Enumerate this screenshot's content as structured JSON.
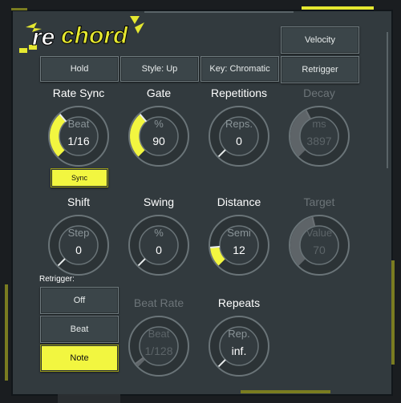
{
  "brand": {
    "logo_text": "rechord"
  },
  "colors": {
    "accent": "#f2f640",
    "panel": "#323a3e",
    "ring": "#5a6468"
  },
  "toolbar": {
    "hold": "Hold",
    "style": "Style: Up",
    "key": "Key: Chromatic",
    "velocity": "Velocity",
    "retrigger": "Retrigger"
  },
  "knobs": {
    "rate_sync": {
      "title": "Rate Sync",
      "unit": "Beat",
      "value": "1/16",
      "level": 0.35,
      "active": true
    },
    "gate": {
      "title": "Gate",
      "unit": "%",
      "value": "90",
      "level": 0.35,
      "active": true
    },
    "repetitions": {
      "title": "Repetitions",
      "unit": "Reps.",
      "value": "0",
      "level": 0,
      "active": true
    },
    "decay": {
      "title": "Decay",
      "unit": "ms",
      "value": "3897",
      "level": 0.4,
      "active": false
    },
    "shift": {
      "title": "Shift",
      "unit": "Step",
      "value": "0",
      "level": 0,
      "active": true
    },
    "swing": {
      "title": "Swing",
      "unit": "%",
      "value": "0",
      "level": 0,
      "active": true
    },
    "distance": {
      "title": "Distance",
      "unit": "Semi",
      "value": "12",
      "level": 0.15,
      "active": true
    },
    "target": {
      "title": "Target",
      "unit": "Value",
      "value": "70",
      "level": 0.45,
      "active": false
    },
    "beat_rate": {
      "title": "Beat Rate",
      "unit": "Beat",
      "value": "1/128",
      "level": 0.03,
      "active": false
    },
    "repeats": {
      "title": "Repeats",
      "unit": "Rep.",
      "value": "inf.",
      "level": 0,
      "active": true
    }
  },
  "sync_button": "Sync",
  "retrigger_section": {
    "label": "Retrigger:",
    "options": [
      "Off",
      "Beat",
      "Note"
    ],
    "selected": "Note"
  }
}
